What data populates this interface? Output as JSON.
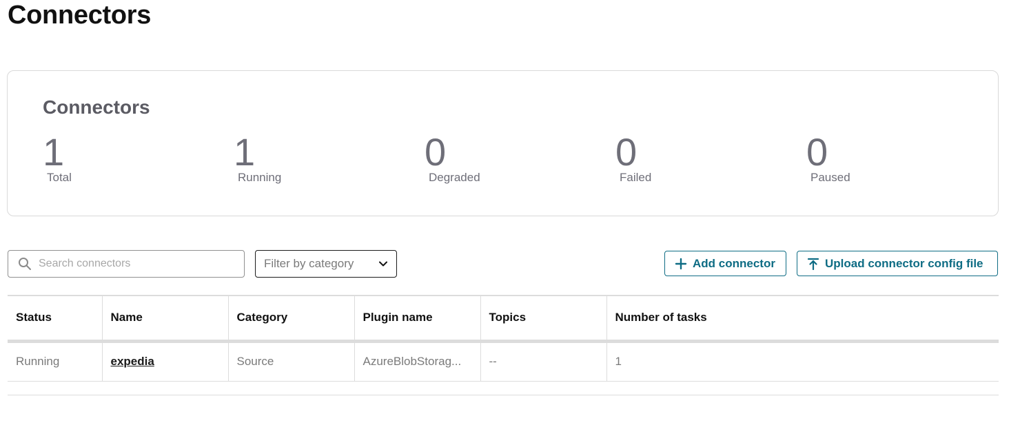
{
  "page": {
    "title": "Connectors"
  },
  "summary": {
    "title": "Connectors",
    "stats": [
      {
        "value": "1",
        "label": "Total"
      },
      {
        "value": "1",
        "label": "Running"
      },
      {
        "value": "0",
        "label": "Degraded"
      },
      {
        "value": "0",
        "label": "Failed"
      },
      {
        "value": "0",
        "label": "Paused"
      }
    ]
  },
  "toolbar": {
    "search_placeholder": "Search connectors",
    "filter_label": "Filter by category",
    "add_label": "Add connector",
    "upload_label": "Upload connector config file"
  },
  "table": {
    "columns": [
      "Status",
      "Name",
      "Category",
      "Plugin name",
      "Topics",
      "Number of tasks"
    ],
    "rows": [
      {
        "status": "Running",
        "name": "expedia",
        "category": "Source",
        "plugin": "AzureBlobStorag...",
        "topics": "--",
        "tasks": "1"
      }
    ]
  },
  "colors": {
    "accent": "#0e6c84",
    "muted_text": "#6e6e78",
    "border": "#dcdcdc"
  },
  "icons": {
    "search": "search-icon",
    "dropdown": "chevron-down-icon",
    "add": "plus-icon",
    "upload": "upload-icon"
  }
}
